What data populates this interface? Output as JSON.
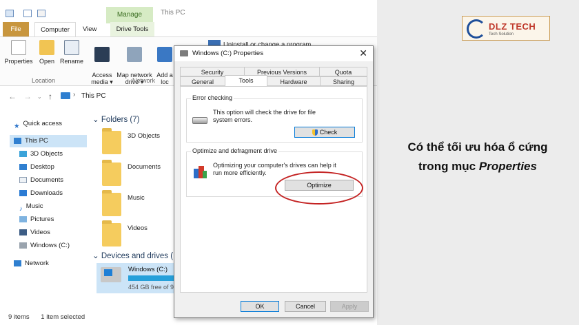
{
  "explorer": {
    "manage_tab": "Manage",
    "title": "This PC",
    "tabs": {
      "file": "File",
      "computer": "Computer",
      "view": "View",
      "drive_tools": "Drive Tools"
    },
    "ribbon": {
      "properties": "Properties",
      "open": "Open",
      "rename": "Rename",
      "access_media": "Access\nmedia ▾",
      "map_network_drive": "Map network\ndrive ▾",
      "add_a": "Add a\nloc",
      "uninstall": "Uninstall or change a program",
      "group_location": "Location",
      "group_network": "Network"
    },
    "address": {
      "location": "This PC"
    },
    "sidebar": {
      "quick_access": "Quick access",
      "this_pc": "This PC",
      "items": [
        "3D Objects",
        "Desktop",
        "Documents",
        "Downloads",
        "Music",
        "Pictures",
        "Videos",
        "Windows (C:)"
      ],
      "network": "Network"
    },
    "content": {
      "folders_header": "Folders (7)",
      "folders": [
        "3D Objects",
        "Documents",
        "Music",
        "Videos"
      ],
      "devices_header": "Devices and drives (",
      "drive_name": "Windows (C:)",
      "drive_free": "454 GB free of 9",
      "drive_used_fraction": 1.0
    },
    "status": {
      "items": "9 items",
      "selected": "1 item selected"
    }
  },
  "dialog": {
    "title": "Windows (C:) Properties",
    "close": "✕",
    "tabs_row1": [
      "Security",
      "Previous Versions",
      "Quota"
    ],
    "tabs_row2": [
      "General",
      "Tools",
      "Hardware",
      "Sharing"
    ],
    "active_tab": "Tools",
    "error_checking": {
      "title": "Error checking",
      "text": "This option will check the drive for file system errors.",
      "button": "Check"
    },
    "optimize": {
      "title": "Optimize and defragment drive",
      "text": "Optimizing your computer's drives can help it run more efficiently.",
      "button": "Optimize"
    },
    "buttons": {
      "ok": "OK",
      "cancel": "Cancel",
      "apply": "Apply"
    }
  },
  "brand": {
    "name": "DLZ TECH",
    "tagline": "Tech Solution"
  },
  "caption": {
    "line1": "Có thể tối ưu hóa ổ cứng",
    "line2_prefix": "trong mục ",
    "line2_emphasis": "Properties"
  },
  "colors": {
    "highlight_circle": "#c42323",
    "file_tab": "#c8963e",
    "selection": "#cce4f7",
    "background": "#ececec"
  }
}
